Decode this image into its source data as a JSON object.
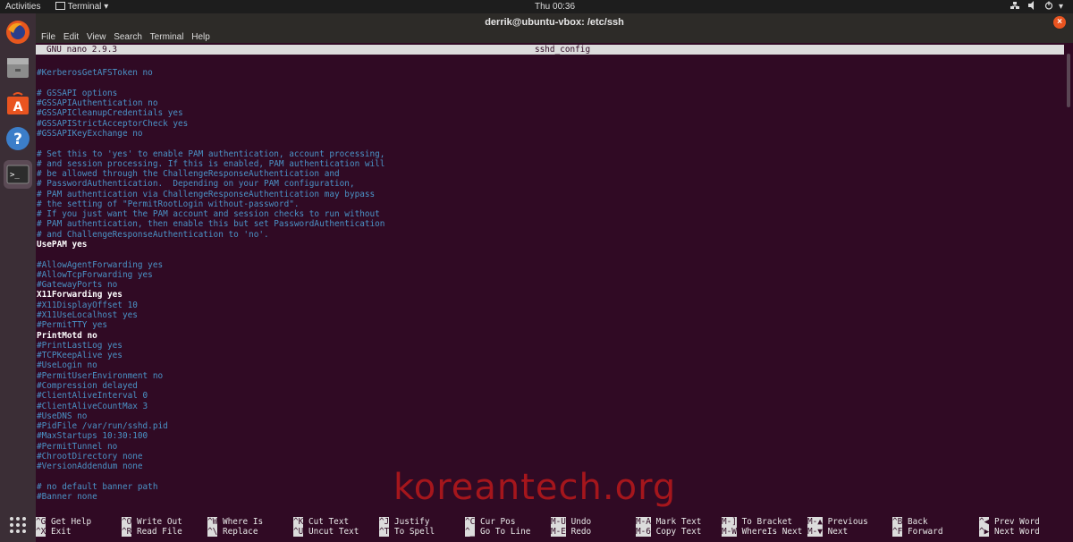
{
  "topbar": {
    "activities": "Activities",
    "app_menu": "Terminal",
    "clock": "Thu 00:36"
  },
  "dock": {
    "items": [
      "firefox-icon",
      "files-icon",
      "software-icon",
      "help-icon",
      "terminal-icon"
    ],
    "apps_grid": "show-apps-icon"
  },
  "window": {
    "title": "derrik@ubuntu-vbox: /etc/ssh",
    "menu": [
      "File",
      "Edit",
      "View",
      "Search",
      "Terminal",
      "Help"
    ]
  },
  "nano": {
    "version": "GNU nano 2.9.3",
    "filename": "sshd_config",
    "lines": [
      "",
      "#KerberosGetAFSToken no",
      "",
      "# GSSAPI options",
      "#GSSAPIAuthentication no",
      "#GSSAPICleanupCredentials yes",
      "#GSSAPIStrictAcceptorCheck yes",
      "#GSSAPIKeyExchange no",
      "",
      "# Set this to 'yes' to enable PAM authentication, account processing,",
      "# and session processing. If this is enabled, PAM authentication will",
      "# be allowed through the ChallengeResponseAuthentication and",
      "# PasswordAuthentication.  Depending on your PAM configuration,",
      "# PAM authentication via ChallengeResponseAuthentication may bypass",
      "# the setting of \"PermitRootLogin without-password\".",
      "# If you just want the PAM account and session checks to run without",
      "# PAM authentication, then enable this but set PasswordAuthentication",
      "# and ChallengeResponseAuthentication to 'no'.",
      "UsePAM yes",
      "",
      "#AllowAgentForwarding yes",
      "#AllowTcpForwarding yes",
      "#GatewayPorts no",
      "X11Forwarding yes",
      "#X11DisplayOffset 10",
      "#X11UseLocalhost yes",
      "#PermitTTY yes",
      "PrintMotd no",
      "#PrintLastLog yes",
      "#TCPKeepAlive yes",
      "#UseLogin no",
      "#PermitUserEnvironment no",
      "#Compression delayed",
      "#ClientAliveInterval 0",
      "#ClientAliveCountMax 3",
      "#UseDNS no",
      "#PidFile /var/run/sshd.pid",
      "#MaxStartups 10:30:100",
      "#PermitTunnel no",
      "#ChrootDirectory none",
      "#VersionAddendum none",
      "",
      "# no default banner path",
      "#Banner none"
    ],
    "active_lines": [
      "UsePAM yes",
      "X11Forwarding yes",
      "PrintMotd no"
    ],
    "shortcuts_row1": [
      {
        "key": "^G",
        "label": "Get Help"
      },
      {
        "key": "^O",
        "label": "Write Out"
      },
      {
        "key": "^W",
        "label": "Where Is"
      },
      {
        "key": "^K",
        "label": "Cut Text"
      },
      {
        "key": "^J",
        "label": "Justify"
      },
      {
        "key": "^C",
        "label": "Cur Pos"
      },
      {
        "key": "M-U",
        "label": "Undo"
      },
      {
        "key": "M-A",
        "label": "Mark Text"
      },
      {
        "key": "M-]",
        "label": "To Bracket"
      },
      {
        "key": "M-▲",
        "label": "Previous"
      },
      {
        "key": "^B",
        "label": "Back"
      },
      {
        "key": "^◀",
        "label": "Prev Word"
      }
    ],
    "shortcuts_row2": [
      {
        "key": "^X",
        "label": "Exit"
      },
      {
        "key": "^R",
        "label": "Read File"
      },
      {
        "key": "^\\",
        "label": "Replace"
      },
      {
        "key": "^U",
        "label": "Uncut Text"
      },
      {
        "key": "^T",
        "label": "To Spell"
      },
      {
        "key": "^_",
        "label": "Go To Line"
      },
      {
        "key": "M-E",
        "label": "Redo"
      },
      {
        "key": "M-6",
        "label": "Copy Text"
      },
      {
        "key": "M-W",
        "label": "WhereIs Next"
      },
      {
        "key": "M-▼",
        "label": "Next"
      },
      {
        "key": "^F",
        "label": "Forward"
      },
      {
        "key": "^▶",
        "label": "Next Word"
      }
    ]
  },
  "watermark": "koreantech.org",
  "colors": {
    "terminal_bg": "#300a24",
    "comment": "#4a93c7",
    "active": "#ffffff",
    "topbar_bg": "#1d1d1d"
  }
}
